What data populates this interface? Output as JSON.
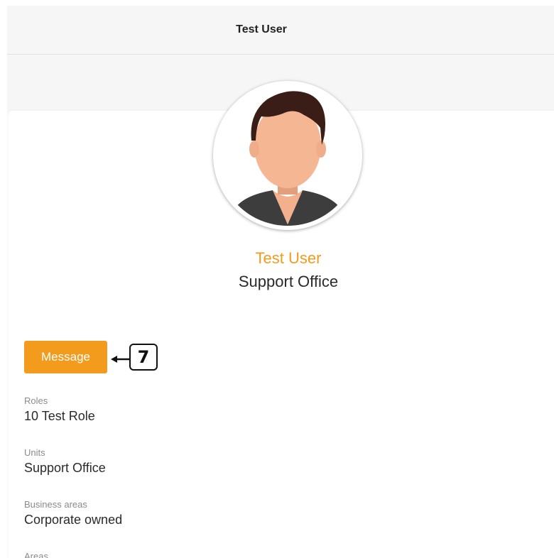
{
  "header": {
    "title": "Test User"
  },
  "profile": {
    "name": "Test User",
    "unit": "Support Office",
    "avatar_icon": "user-avatar-icon"
  },
  "actions": {
    "message_label": "Message"
  },
  "annotation": {
    "number": "7"
  },
  "fields": [
    {
      "label": "Roles",
      "value": "10 Test Role"
    },
    {
      "label": "Units",
      "value": "Support Office"
    },
    {
      "label": "Business areas",
      "value": "Corporate owned"
    },
    {
      "label": "Areas",
      "value": ""
    }
  ],
  "colors": {
    "accent": "#f29b1d",
    "text": "#2a2a2a",
    "muted": "#8a8a8a",
    "header_bg": "#f6f6f6"
  }
}
